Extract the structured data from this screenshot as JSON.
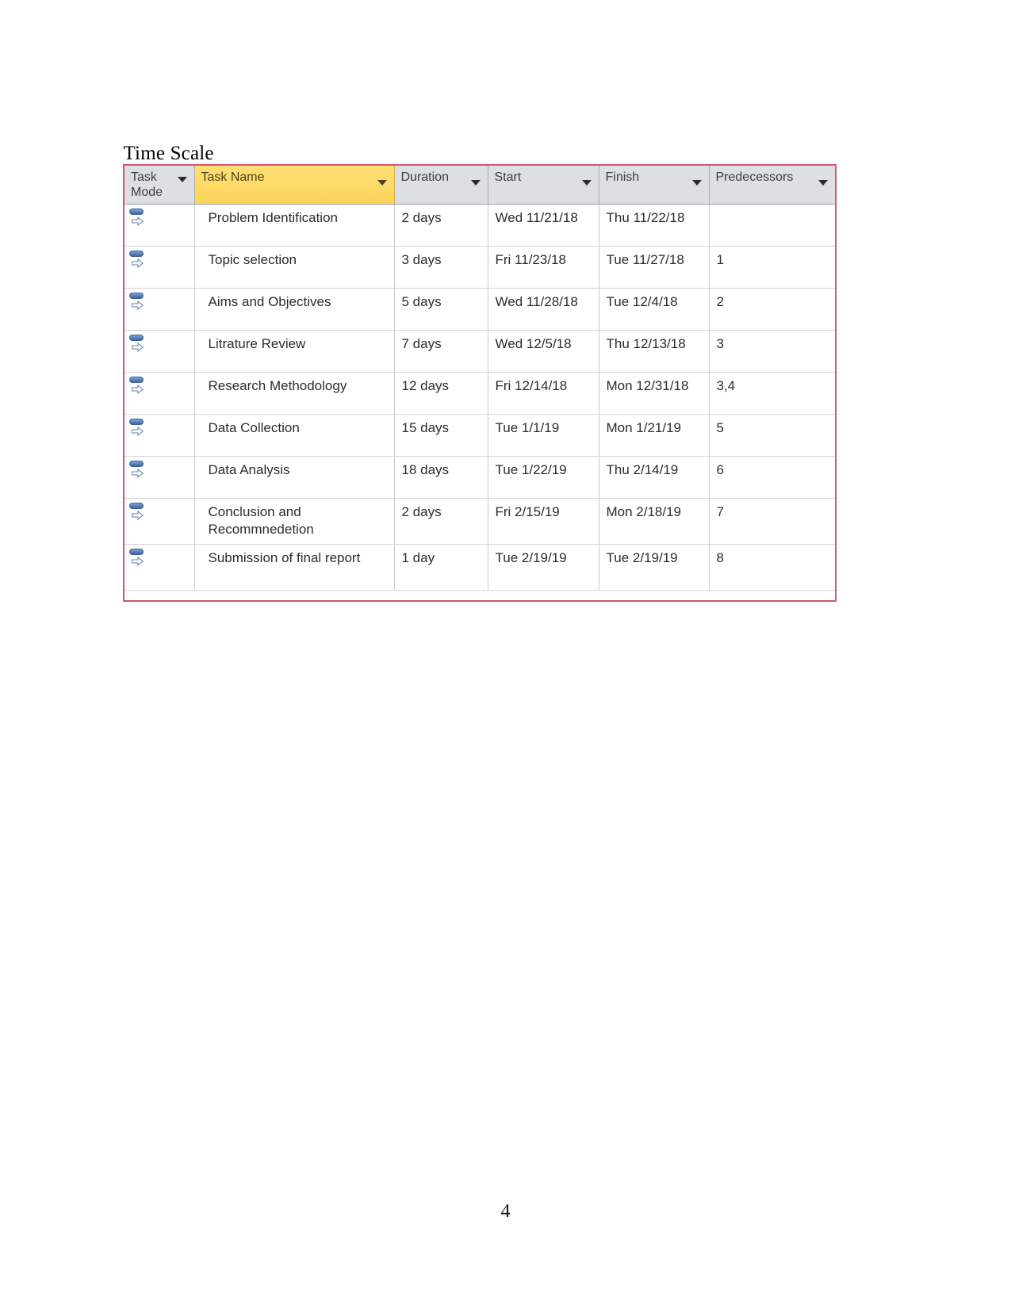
{
  "document": {
    "heading": "Time Scale ",
    "page_number": "4"
  },
  "table": {
    "border_color": "#d9536f",
    "header_background": "#dcdfe3",
    "highlight_column_color": "#ffd75e",
    "columns": [
      {
        "id": "task_mode",
        "label": "Task\nMode",
        "has_filter": true,
        "highlighted": false
      },
      {
        "id": "task_name",
        "label": "Task Name",
        "has_filter": true,
        "highlighted": true
      },
      {
        "id": "duration",
        "label": "Duration",
        "has_filter": true,
        "highlighted": false
      },
      {
        "id": "start",
        "label": "Start",
        "has_filter": true,
        "highlighted": false
      },
      {
        "id": "finish",
        "label": "Finish",
        "has_filter": true,
        "highlighted": false
      },
      {
        "id": "predecessors",
        "label": "Predecessors",
        "has_filter": true,
        "highlighted": false
      }
    ],
    "rows": [
      {
        "task_mode_icon": "auto-scheduled-icon",
        "task_name": "Problem Identification",
        "duration": "2 days",
        "start": "Wed 11/21/18",
        "finish": "Thu 11/22/18",
        "predecessors": ""
      },
      {
        "task_mode_icon": "auto-scheduled-icon",
        "task_name": "Topic selection",
        "duration": "3 days",
        "start": "Fri 11/23/18",
        "finish": "Tue 11/27/18",
        "predecessors": "1"
      },
      {
        "task_mode_icon": "auto-scheduled-icon",
        "task_name": "Aims and Objectives",
        "duration": "5 days",
        "start": "Wed 11/28/18",
        "finish": "Tue 12/4/18",
        "predecessors": "2"
      },
      {
        "task_mode_icon": "auto-scheduled-icon",
        "task_name": "Litrature Review",
        "duration": "7 days",
        "start": "Wed 12/5/18",
        "finish": "Thu 12/13/18",
        "predecessors": "3"
      },
      {
        "task_mode_icon": "auto-scheduled-icon",
        "task_name": "Research Methodology",
        "duration": "12 days",
        "start": "Fri 12/14/18",
        "finish": "Mon 12/31/18",
        "predecessors": "3,4"
      },
      {
        "task_mode_icon": "auto-scheduled-icon",
        "task_name": "Data Collection",
        "duration": "15 days",
        "start": "Tue 1/1/19",
        "finish": "Mon 1/21/19",
        "predecessors": "5"
      },
      {
        "task_mode_icon": "auto-scheduled-icon",
        "task_name": "Data Analysis",
        "duration": "18 days",
        "start": "Tue 1/22/19",
        "finish": "Thu 2/14/19",
        "predecessors": "6"
      },
      {
        "task_mode_icon": "auto-scheduled-icon",
        "task_name": "Conclusion and Recommnedetion",
        "duration": "2 days",
        "start": "Fri 2/15/19",
        "finish": "Mon 2/18/19",
        "predecessors": "7"
      },
      {
        "task_mode_icon": "auto-scheduled-icon",
        "task_name": "Submission of final report",
        "duration": "1 day",
        "start": "Tue 2/19/19",
        "finish": "Tue 2/19/19",
        "predecessors": "8"
      }
    ]
  }
}
